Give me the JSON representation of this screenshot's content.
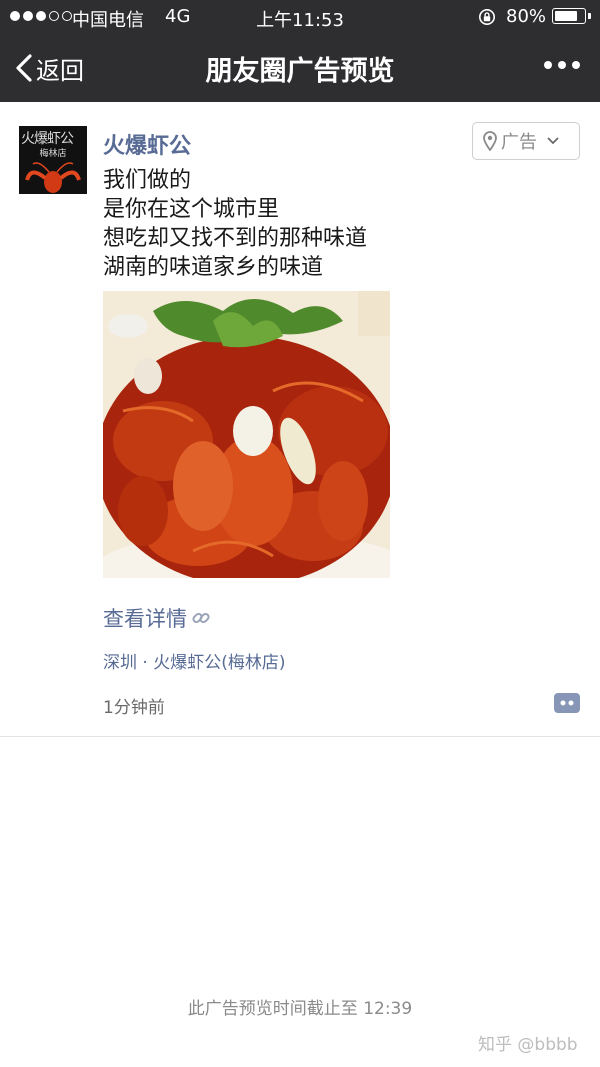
{
  "status_bar": {
    "carrier": "中国电信",
    "network": "4G",
    "time": "上午11:53",
    "battery_percent": "80%",
    "battery_level": 0.8,
    "signal_bars": 3,
    "icons": [
      "signal-icon",
      "rotation-lock-icon",
      "battery-icon"
    ]
  },
  "nav": {
    "back_label": "返回",
    "title": "朋友圈广告预览",
    "icons": [
      "back-chevron-icon",
      "more-icon"
    ]
  },
  "post": {
    "avatar": {
      "name": "火爆虾公",
      "sub": "梅林店"
    },
    "author": "火爆虾公",
    "ad_tag": "广告",
    "content_lines": [
      "我们做的",
      "是你在这个城市里",
      "想吃却又找不到的那种味道",
      "湖南的味道家乡的味道"
    ],
    "detail_link": "查看详情",
    "location": "深圳 · 火爆虾公(梅林店)",
    "time": "1分钟前",
    "icons": [
      "location-pin-icon",
      "chevron-down-icon",
      "link-icon",
      "comment-icon"
    ]
  },
  "footer": {
    "notice": "此广告预览时间截止至 12:39",
    "watermark": "知乎 @bbbb"
  },
  "colors": {
    "header_bg": "#2e2e31",
    "link_blue": "#576b95",
    "crayfish_red": "#c23a12"
  }
}
